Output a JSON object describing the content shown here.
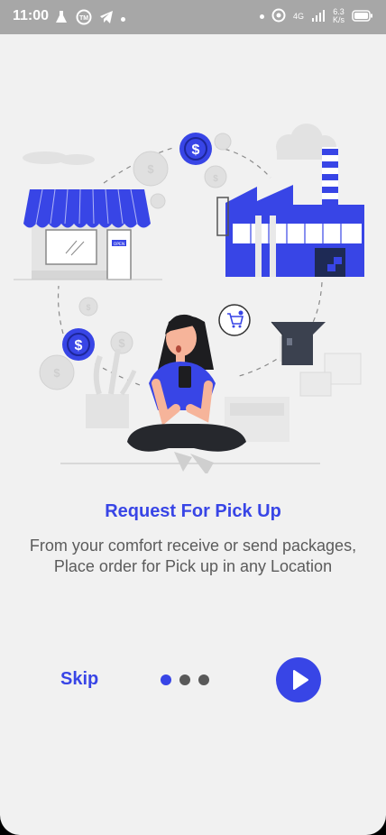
{
  "status_bar": {
    "time": "11:00",
    "network_type": "4G",
    "speed_value": "6.3",
    "speed_unit": "K/s"
  },
  "onboarding": {
    "title": "Request For Pick Up",
    "description_line1": "From your comfort receive or send packages,",
    "description_line2": "Place order for Pick up in any Location",
    "skip_label": "Skip",
    "pages": [
      {
        "active": true
      },
      {
        "active": false
      },
      {
        "active": false
      }
    ],
    "store_sign_text": "OPEN"
  },
  "colors": {
    "accent": "#3845e6",
    "background": "#f1f1f1",
    "status_bar": "#a7a7a7"
  }
}
